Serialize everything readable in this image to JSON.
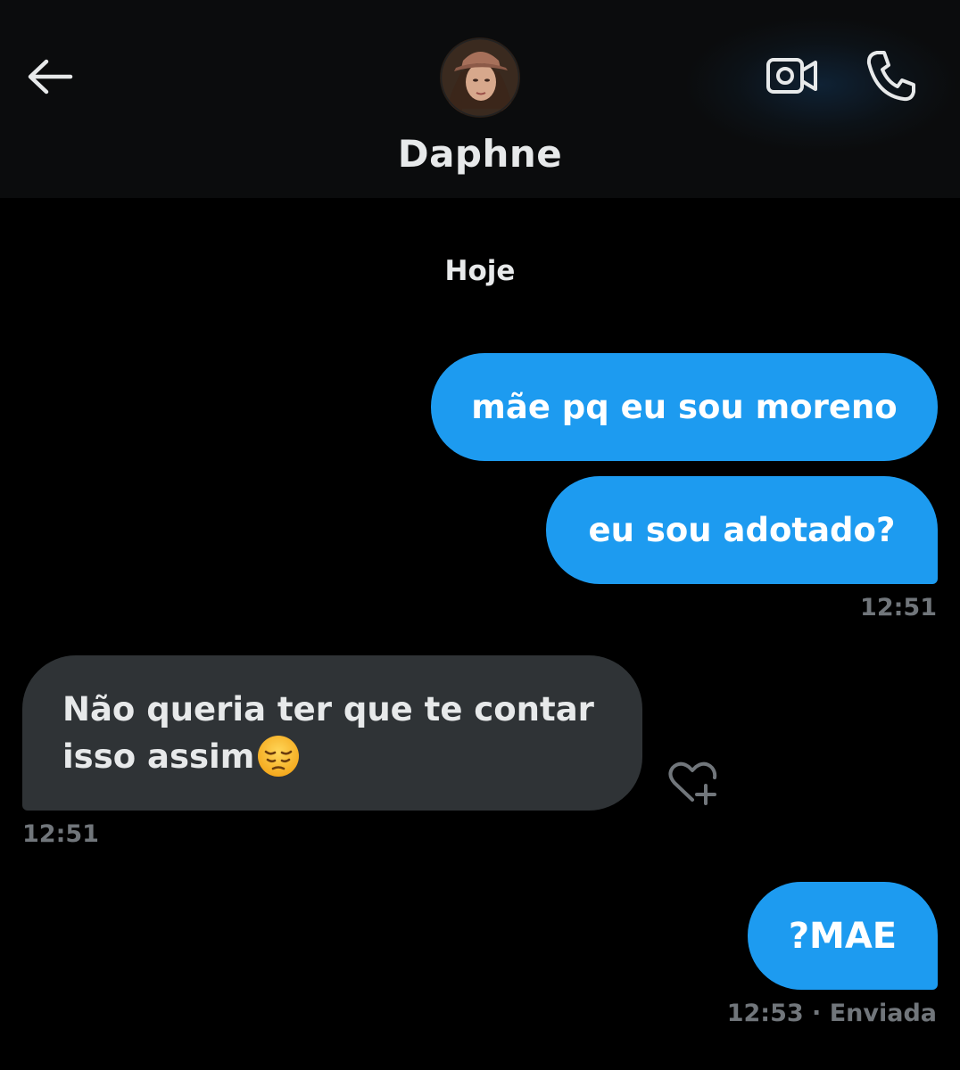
{
  "header": {
    "contact_name": "Daphne",
    "back_icon": "arrow-left-icon",
    "video_icon": "video-camera-icon",
    "call_icon": "phone-icon",
    "avatar": "contact-avatar"
  },
  "conversation": {
    "day_separator": "Hoje",
    "messages": [
      {
        "direction": "sent",
        "text": "mãe pq eu sou moreno"
      },
      {
        "direction": "sent",
        "text": "eu sou adotado?"
      },
      {
        "direction": "received",
        "text": "Não queria ter que te contar isso assim",
        "emoji": "pensive-face"
      },
      {
        "direction": "sent",
        "text": "?MAE"
      }
    ],
    "timestamps": {
      "sent_group_1": "12:51",
      "received_1": "12:51",
      "sent_last": "12:53 · Enviada"
    }
  },
  "colors": {
    "background": "#000000",
    "header": "#0b0c0d",
    "sent_bubble": "#1d9bf0",
    "received_bubble": "#2f3336",
    "primary_text": "#e7e9ea",
    "secondary_text": "#71767b"
  },
  "icons": {
    "reaction": "heart-plus-icon"
  }
}
